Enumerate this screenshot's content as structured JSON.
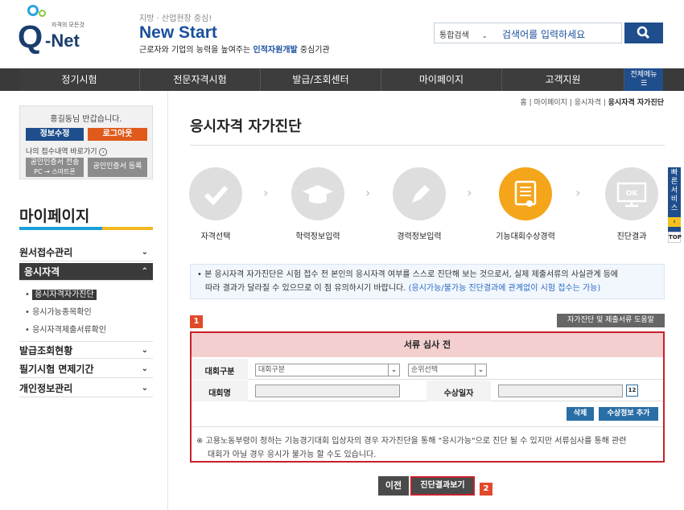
{
  "header": {
    "logo_text": "Q-Net",
    "logo_tag": "자격의 모든것",
    "slogan_top": "지방 · 산업현장 중심!",
    "slogan_main": "New Start",
    "slogan_sub_pre": "근로자와 기업의 능력을 높여주는 ",
    "slogan_sub_bold": "인적자원개발",
    "slogan_sub_post": " 중심기관",
    "search_select": "통합검색",
    "search_placeholder": "검색어를 입력하세요"
  },
  "nav": {
    "items": [
      "정기시험",
      "전문자격시험",
      "발급/조회센터",
      "마이페이지",
      "고객지원"
    ],
    "all_menu": "전체메뉴"
  },
  "sidebar": {
    "greeting": "홍길동님 반갑습니다.",
    "info_edit": "정보수정",
    "logout": "로그아웃",
    "my_receipt": "나의 접수내역 바로가기",
    "cert_send_1": "공인인증서 전송",
    "cert_send_2": "PC → 스마트폰",
    "cert_register": "공인인증서 등록",
    "title": "마이페이지",
    "menu": {
      "receipt": "원서접수관리",
      "qualification": "응시자격",
      "sub": [
        "응시자격자가진단",
        "응시가능종목확인",
        "응시자격제출서류확인"
      ],
      "issue": "발급조회현황",
      "exempt": "필기시험 면제기간",
      "privacy": "개인정보관리"
    }
  },
  "content": {
    "breadcrumb_home": "홈",
    "breadcrumb_mypage": "마이페이지",
    "breadcrumb_qual": "응시자격",
    "breadcrumb_current": "응시자격 자가진단",
    "title": "응시자격 자가진단",
    "steps": [
      "자격선택",
      "학력정보입력",
      "경력정보입력",
      "기능대회수상경력",
      "진단결과"
    ],
    "notice_1": "• 본 응시자격 자가진단은 시험 접수 전 본인의 응시자격 여부를 스스로 진단해 보는 것으로서, 실제 제출서류의 사실관계 등에",
    "notice_2": "따라 결과가 달라질 수 있으므로 이 점 유의하시기 바랍니다.",
    "notice_blue": "(응시가능/불가능 진단결과에 관계없이 시험 접수는 가능)",
    "badge1": "1",
    "badge2": "2",
    "help_button": "자가진단 및 제출서류 도움말",
    "form_header": "서류 심사 전",
    "label_division": "대회구분",
    "select_division": "대회구분",
    "select_rank": "순위선택",
    "label_name": "대회명",
    "label_date": "수상일자",
    "calendar": "12",
    "delete_button": "삭제",
    "add_button": "수상정보 추가",
    "footnote_1": "※ 고용노동부령이 정하는 기능경기대회 입상자의 경우 자가진단을 통해 \"응시가능\"으로 진단 될 수 있지만 서류심사를 통해 관련",
    "footnote_2": "대회가 아닐 경우 응시가 불가능 할 수도 있습니다.",
    "prev_button": "이전",
    "result_button": "진단결과보기"
  },
  "quick": {
    "label": "빠른서비스",
    "top": "TOP"
  }
}
